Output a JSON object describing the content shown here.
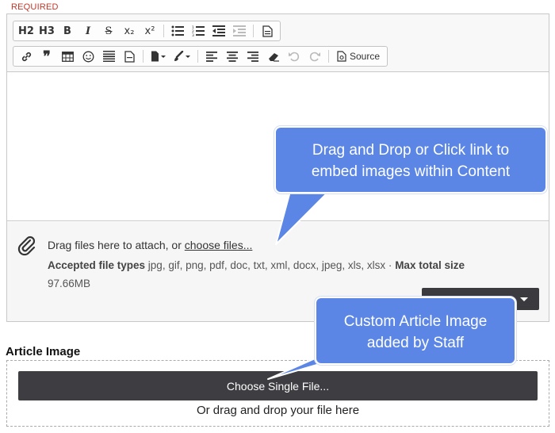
{
  "required_label": "REQUIRED",
  "toolbar": {
    "row1": [
      {
        "id": "h2",
        "label": "H2",
        "icon": "heading-2"
      },
      {
        "id": "h3",
        "label": "H3",
        "icon": "heading-3"
      },
      {
        "id": "bold",
        "label": "B",
        "icon": "bold"
      },
      {
        "id": "italic",
        "label": "I",
        "icon": "italic"
      },
      {
        "id": "strike",
        "label": "S",
        "icon": "strikethrough"
      },
      {
        "id": "subscript",
        "label": "x₂",
        "icon": "subscript"
      },
      {
        "id": "superscript",
        "label": "x²",
        "icon": "superscript"
      }
    ],
    "source_label": "Source"
  },
  "attach": {
    "prefix": "Drag files here to attach, or ",
    "link": "choose files...",
    "types_label": "Accepted file types",
    "types": " jpg, gif, png, pdf, doc, txt, xml, docx, jpeg, xls, xlsx · ",
    "max_label": "Max total size",
    "max_value": "97.66MB"
  },
  "callouts": {
    "content": [
      "Drag and Drop or Click link to",
      "embed images within Content"
    ],
    "image": [
      "Custom Article Image",
      "added by Staff"
    ]
  },
  "article_image": {
    "label": "Article Image",
    "button": "Choose Single File...",
    "drop_text": "Or drag and drop your file here"
  },
  "colors": {
    "callout": "#5b86e5",
    "dark_button": "#3d3d42",
    "required": "#c0392b"
  }
}
